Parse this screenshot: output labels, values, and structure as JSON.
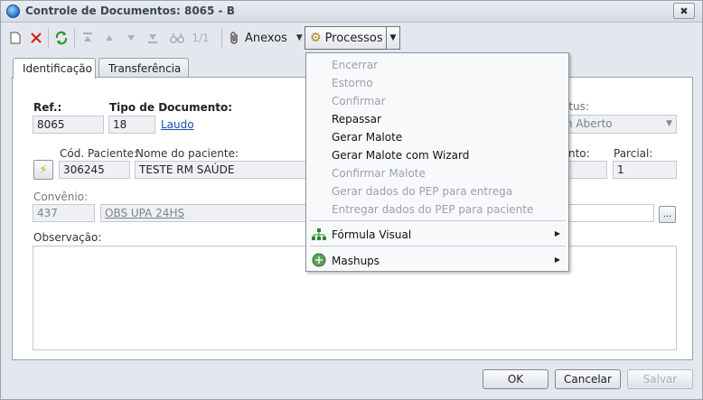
{
  "window": {
    "title": "Controle de Documentos: 8065 - B",
    "close": "✖"
  },
  "toolbar": {
    "record_counter": "1/1",
    "anexos_label": "Anexos",
    "processos_label": "Processos"
  },
  "tabs": [
    {
      "label": "Identificação"
    },
    {
      "label": "Transferência"
    }
  ],
  "form": {
    "ref_label": "Ref.:",
    "ref_value": "8065",
    "tipo_label": "Tipo de Documento:",
    "tipo_code": "18",
    "tipo_link": "Laudo",
    "status_label": "atus:",
    "status_value": "n Aberto",
    "cod_paciente_label": "Cód. Paciente:",
    "cod_paciente_value": "306245",
    "nome_label": "Nome do paciente:",
    "nome_value": "TESTE RM SAÚDE",
    "nto_label": "nto:",
    "parcial_label": "Parcial:",
    "parcial_value": "1",
    "convenio_label": "Convênio:",
    "convenio_code": "437",
    "convenio_name": "OBS UPA 24HS",
    "ellipsis": "...",
    "observacao_label": "Observação:"
  },
  "footer": {
    "ok": "OK",
    "cancelar": "Cancelar",
    "salvar": "Salvar"
  },
  "menu": {
    "items": [
      {
        "label": "Encerrar"
      },
      {
        "label": "Estorno"
      },
      {
        "label": "Confirmar"
      },
      {
        "label": "Repassar"
      },
      {
        "label": "Gerar Malote"
      },
      {
        "label": "Gerar Malote com Wizard"
      },
      {
        "label": "Confirmar Malote"
      },
      {
        "label": "Gerar dados do PEP para entrega"
      },
      {
        "label": "Entregar dados do PEP para paciente"
      }
    ],
    "formula_visual": "Fórmula Visual",
    "mashups": "Mashups"
  },
  "colors": {
    "accent": "#1a4fb8",
    "disabled_text": "#9aa2ac",
    "window_bg": "#e4e8ee"
  }
}
